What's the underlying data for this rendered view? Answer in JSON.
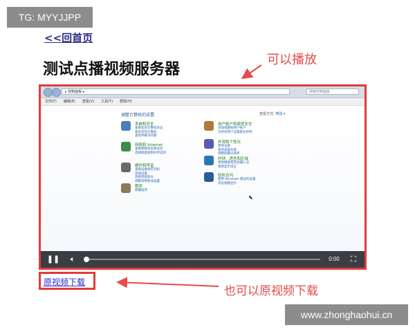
{
  "badge": {
    "text": "TG: MYYJJPP"
  },
  "nav": {
    "back_label": "<<回首页"
  },
  "page": {
    "title": "测试点播视频服务器"
  },
  "annotations": {
    "playable": "可以播放",
    "downloadable": "也可以原视频下载",
    "color": "#e64a4a"
  },
  "video": {
    "screen": {
      "address": "▸ 控制面板 ▸",
      "search_placeholder": "搜索控制面板",
      "menu": [
        "文件(F)",
        "编辑(E)",
        "查看(V)",
        "工具(T)",
        "帮助(H)"
      ],
      "heading": "调整计算机的设置",
      "view_by_label": "查看方式:",
      "view_by_value": "类别 ▾",
      "categories": [
        {
          "title": "系统和安全",
          "links": [
            "查看您的计算机状态",
            "备份您的计算机",
            "查找并解决问题"
          ],
          "icon": "shield-icon",
          "color": "#4a7fc1"
        },
        {
          "title": "网络和 Internet",
          "links": [
            "查看网络状态和任务",
            "选择家庭组和共享选项"
          ],
          "icon": "globe-icon",
          "color": "#3a8f4a"
        },
        {
          "title": "硬件和声音",
          "links": [
            "查看设备和打印机",
            "添加设备",
            "连接到投影仪",
            "调整常用移动设置"
          ],
          "icon": "printer-icon",
          "color": "#6a6a6a"
        },
        {
          "title": "程序",
          "links": [
            "卸载程序"
          ],
          "icon": "programs-icon",
          "color": "#8a7a5a"
        },
        {
          "title": "用户帐户和家庭安全",
          "links": [
            "添加或删除用户帐户",
            "为所有用户设置家长控制"
          ],
          "icon": "users-icon",
          "color": "#b07a3a"
        },
        {
          "title": "外观和个性化",
          "links": [
            "更改主题",
            "更改桌面背景",
            "调整屏幕分辨率"
          ],
          "icon": "appearance-icon",
          "color": "#5a5ab0"
        },
        {
          "title": "时钟、语言和区域",
          "links": [
            "更改键盘或其他输入法",
            "更改显示语言"
          ],
          "icon": "clock-icon",
          "color": "#2a7ab0"
        },
        {
          "title": "轻松访问",
          "links": [
            "使用 Windows 建议的设置",
            "优化视频显示"
          ],
          "icon": "accessibility-icon",
          "color": "#2a5a9a"
        }
      ]
    },
    "controls": {
      "play_pause_icon": "pause-icon",
      "volume_icon": "volume-icon",
      "fullscreen_icon": "fullscreen-icon",
      "time": "0:00",
      "progress": 0
    }
  },
  "download": {
    "label": "原视频下载"
  },
  "watermark": {
    "text": "www.zhonghaohui.cn"
  }
}
